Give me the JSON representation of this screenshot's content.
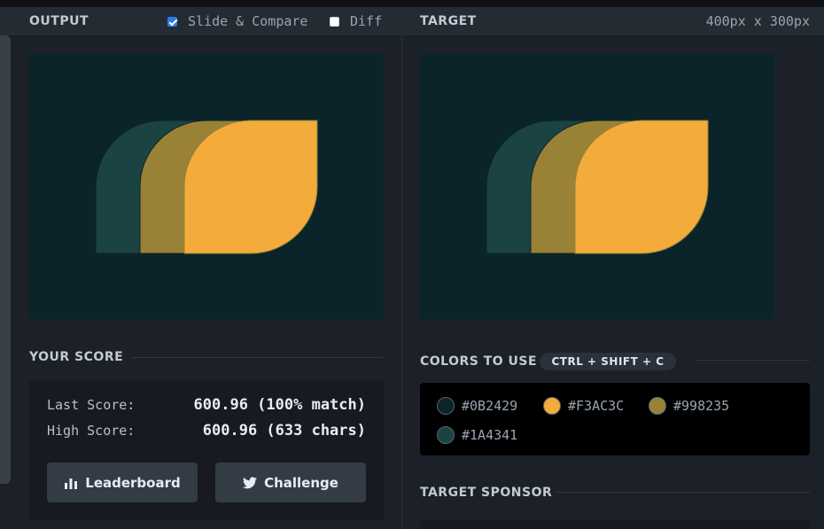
{
  "header": {
    "output_label": "OUTPUT",
    "slide_compare_label": "Slide & Compare",
    "slide_compare_checked": true,
    "diff_label": "Diff",
    "diff_checked": false,
    "target_label": "TARGET",
    "dimensions": "400px x 300px"
  },
  "score": {
    "title": "YOUR SCORE",
    "last_label": "Last Score:",
    "last_value": "600.96 (100% match)",
    "high_label": "High Score:",
    "high_value": "600.96 (633 chars)",
    "leaderboard_label": "Leaderboard",
    "challenge_label": "Challenge"
  },
  "colors": {
    "title": "COLORS TO USE",
    "shortcut": "CTRL + SHIFT + C",
    "swatches": [
      {
        "hex": "#0B2429",
        "label": "#0B2429"
      },
      {
        "hex": "#F3AC3C",
        "label": "#F3AC3C"
      },
      {
        "hex": "#998235",
        "label": "#998235"
      },
      {
        "hex": "#1A4341",
        "label": "#1A4341"
      }
    ]
  },
  "sponsor": {
    "title": "TARGET SPONSOR"
  },
  "icons": {
    "leaderboard": "bar-chart-icon",
    "challenge": "twitter-bird-icon"
  }
}
